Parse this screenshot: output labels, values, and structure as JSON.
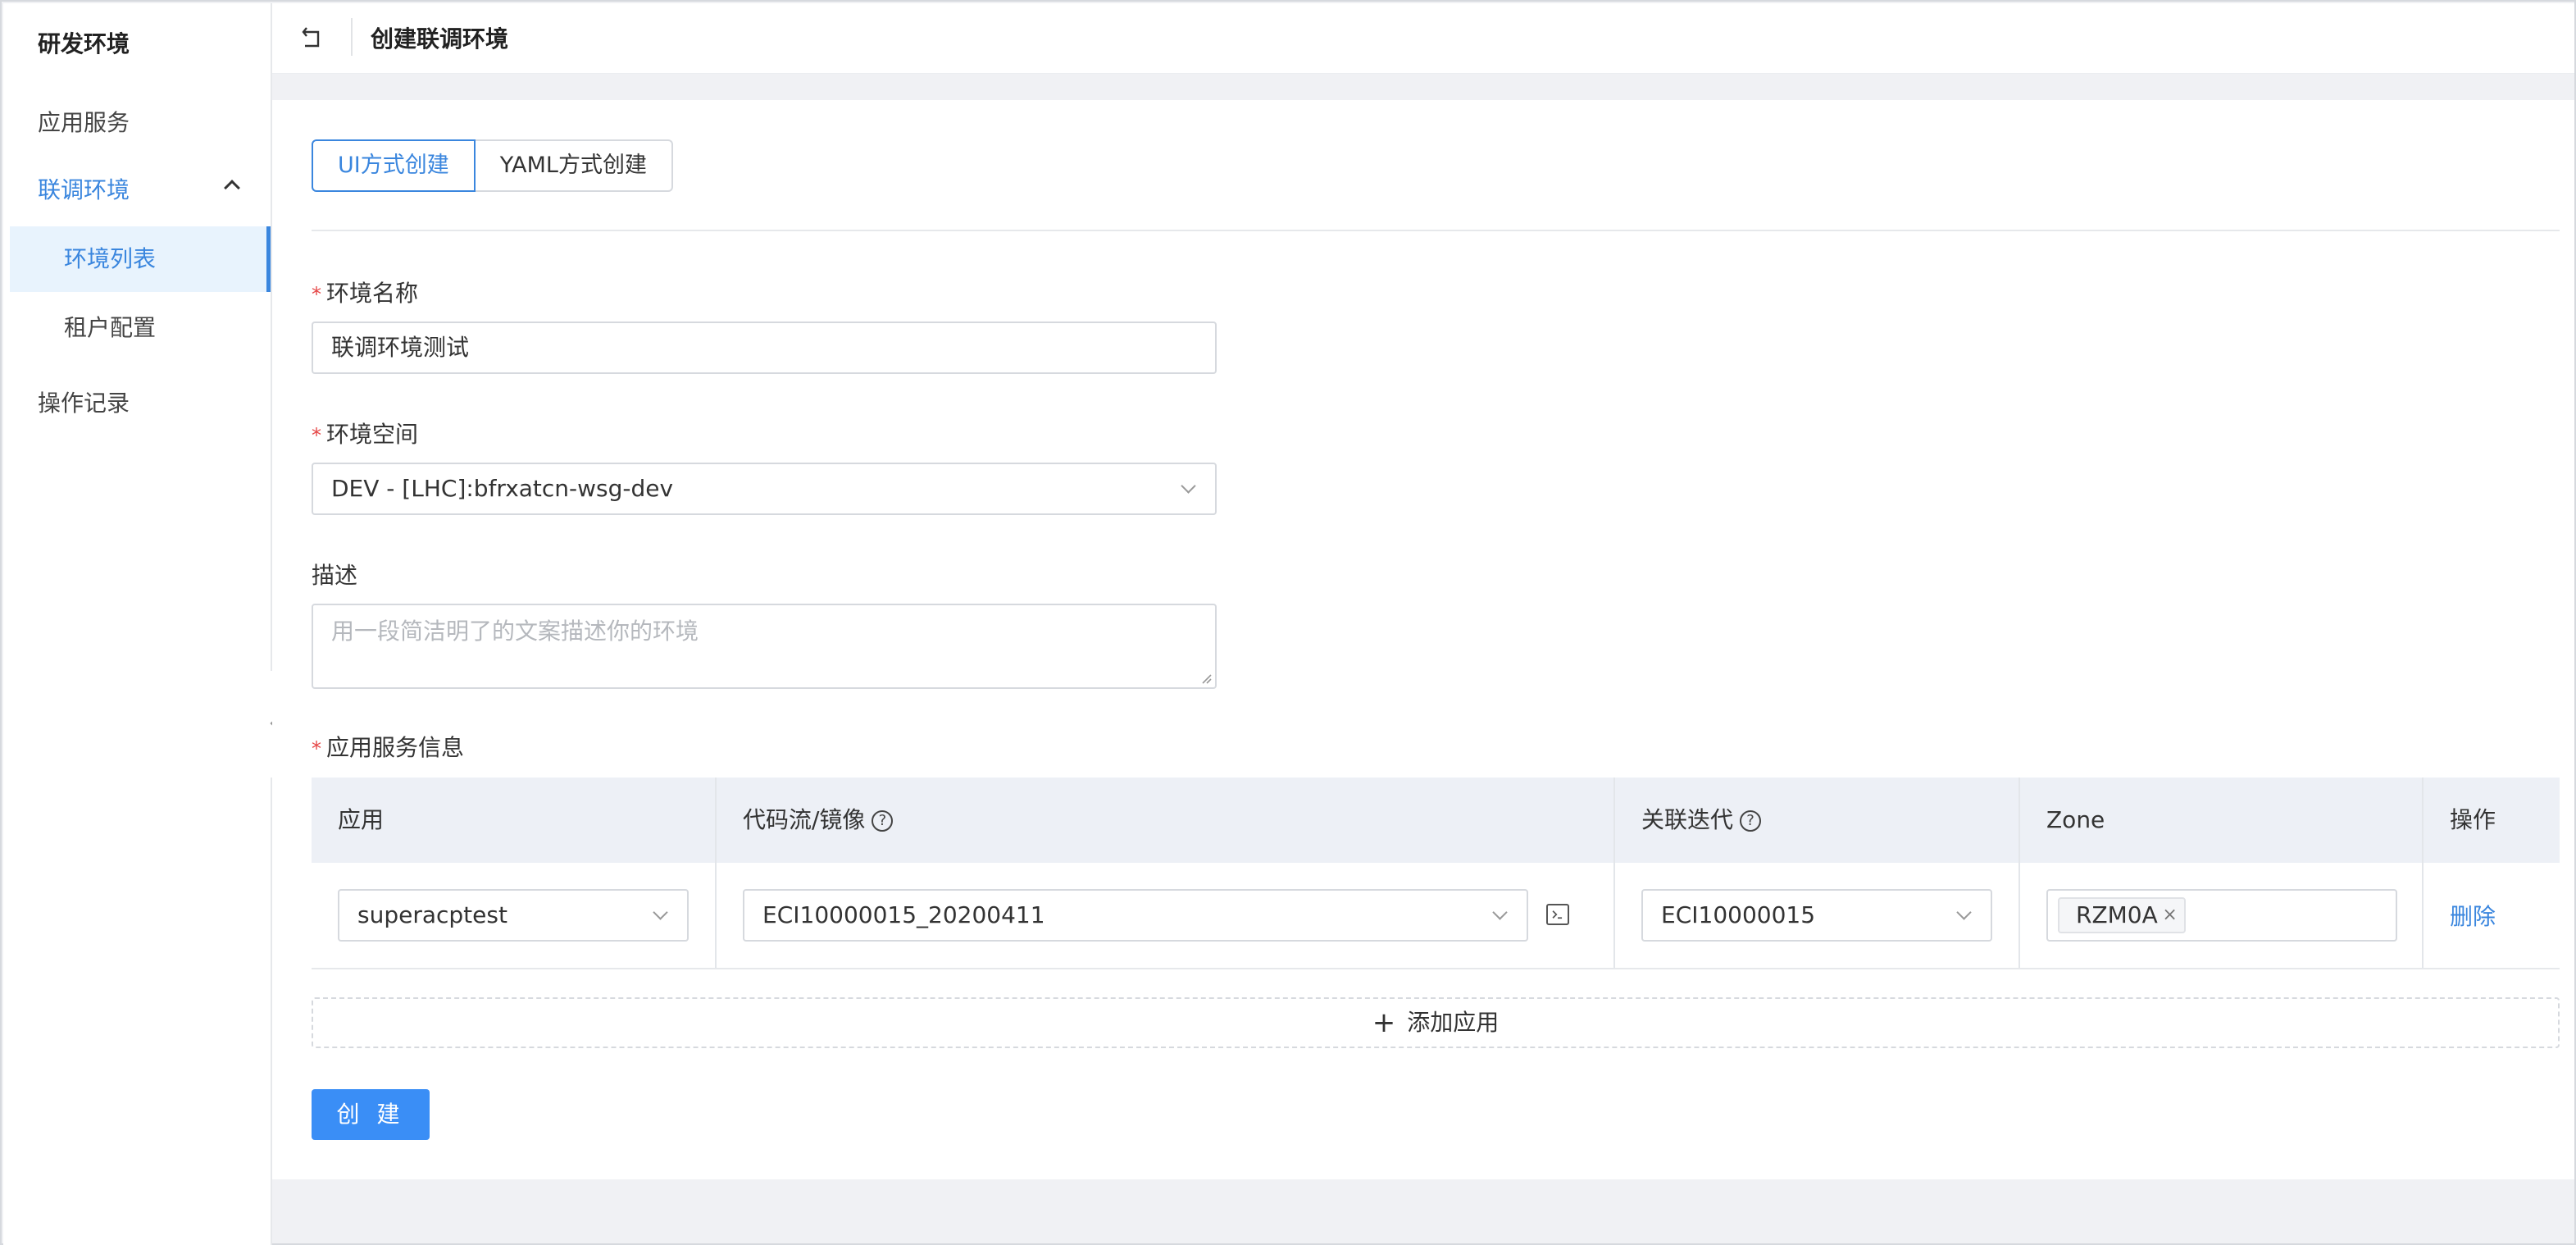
{
  "sidebar": {
    "title": "研发环境",
    "items": [
      {
        "label": "应用服务"
      },
      {
        "label": "联调环境"
      },
      {
        "label": "操作记录"
      }
    ],
    "subitems": [
      {
        "label": "环境列表"
      },
      {
        "label": "租户配置"
      }
    ]
  },
  "header": {
    "title": "创建联调环境"
  },
  "tabs": [
    {
      "label": "UI方式创建"
    },
    {
      "label": "YAML方式创建"
    }
  ],
  "form": {
    "name": {
      "label": "环境名称",
      "value": "联调环境测试"
    },
    "space": {
      "label": "环境空间",
      "value": "DEV - [LHC]:bfrxatcn-wsg-dev"
    },
    "desc": {
      "label": "描述",
      "placeholder": "用一段简洁明了的文案描述你的环境"
    },
    "services_label": "应用服务信息"
  },
  "table": {
    "headers": [
      "应用",
      "代码流/镜像",
      "关联迭代",
      "Zone",
      "操作"
    ],
    "row": {
      "app": "superacptest",
      "code": "ECI10000015_20200411",
      "iteration": "ECI10000015",
      "zone_tag": "RZM0A",
      "action": "删除"
    }
  },
  "add_app": "添加应用",
  "create_button": "创 建",
  "colors": {
    "accent": "#3a86de",
    "primary_button": "#3a8ef6",
    "required": "#e54545"
  }
}
